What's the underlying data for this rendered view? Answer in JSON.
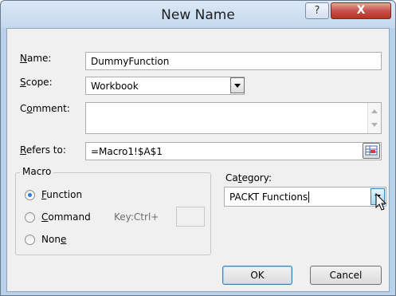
{
  "window": {
    "title": "New Name",
    "help_label": "?",
    "close_label": "X"
  },
  "form": {
    "name_label": {
      "pre": "",
      "acc": "N",
      "post": "ame:"
    },
    "name_value": "DummyFunction",
    "scope_label": {
      "pre": "",
      "acc": "S",
      "post": "cope:"
    },
    "scope_value": "Workbook",
    "comment_label": {
      "pre": "C",
      "acc": "o",
      "post": "mment:"
    },
    "comment_value": "",
    "refers_label": {
      "pre": "",
      "acc": "R",
      "post": "efers to:"
    },
    "refers_value": "=Macro1!$A$1"
  },
  "macro": {
    "group_label": "Macro",
    "function": {
      "pre": "",
      "acc": "F",
      "post": "unction",
      "selected": true
    },
    "command": {
      "pre": "",
      "acc": "C",
      "post": "ommand",
      "selected": false
    },
    "shortcut_label": "Key:Ctrl+",
    "shortcut_value": "",
    "none": {
      "pre": "Non",
      "acc": "e",
      "post": "",
      "selected": false
    }
  },
  "category": {
    "label": {
      "pre": "Ca",
      "acc": "t",
      "post": "egory:"
    },
    "value": "PACKT Functions"
  },
  "buttons": {
    "ok": "OK",
    "cancel": "Cancel"
  },
  "icons": {
    "help": "help-icon",
    "close": "close-icon",
    "dropdown": "chevron-down-icon",
    "range": "range-select-icon",
    "pointer": "mouse-pointer-icon"
  },
  "colors": {
    "title_bg": "#c4d8ee",
    "close_bg": "#c75050",
    "accent": "#2f7ed8"
  }
}
